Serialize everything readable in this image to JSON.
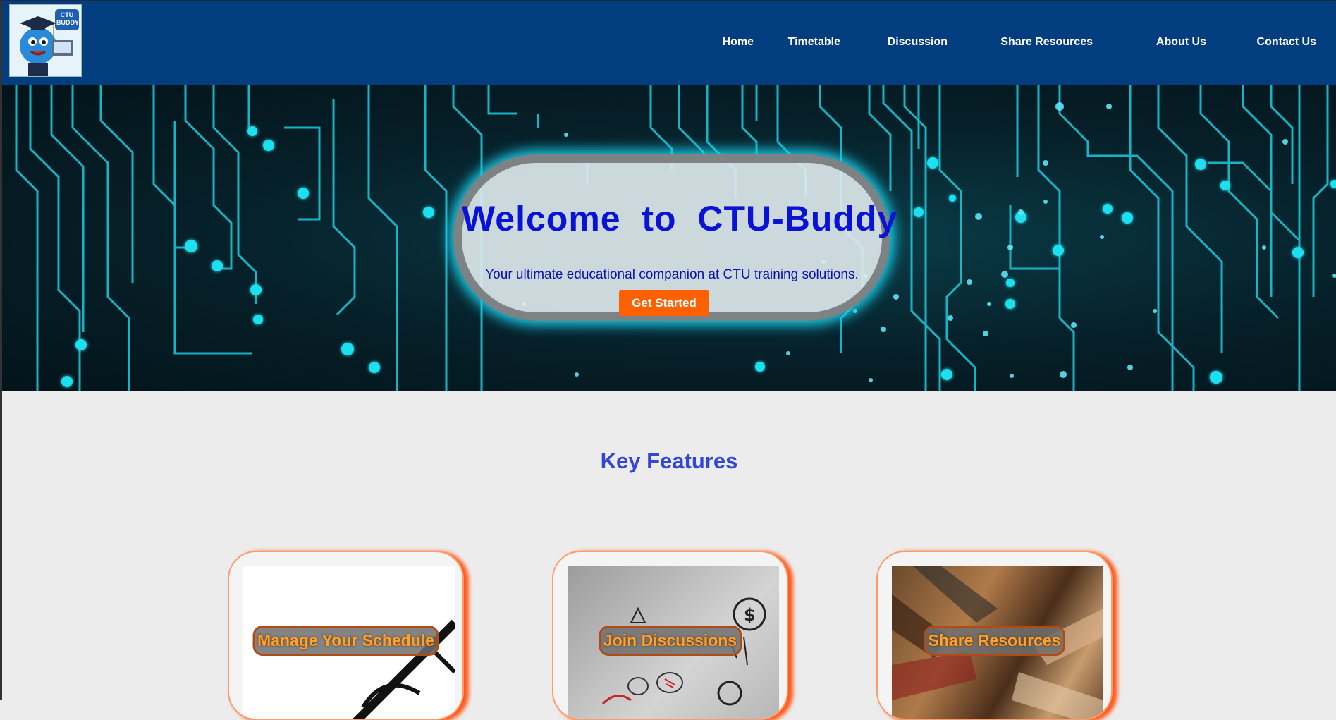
{
  "header": {
    "logo_text_line1": "CTU",
    "logo_text_line2": "BUDDY"
  },
  "nav": {
    "items": [
      {
        "label": "Home"
      },
      {
        "label": "Timetable"
      },
      {
        "label": "Discussion"
      },
      {
        "label": "Share Resources"
      },
      {
        "label": "About Us"
      },
      {
        "label": "Contact Us"
      }
    ]
  },
  "hero": {
    "title": "Welcome  to  CTU-Buddy",
    "subtitle": "Your ultimate educational companion at CTU training solutions.",
    "cta_label": "Get Started"
  },
  "features": {
    "title": "Key Features",
    "cards": [
      {
        "label": "Manage Your Schedule",
        "icon": "schedule-image"
      },
      {
        "label": "Join Discussions",
        "icon": "discussion-image"
      },
      {
        "label": "Share Resources",
        "icon": "teamwork-hands-image"
      }
    ]
  },
  "colors": {
    "header_bg": "#023d80",
    "accent": "#ff6000",
    "title_blue": "#3346d8",
    "glow": "#19d3f0"
  }
}
